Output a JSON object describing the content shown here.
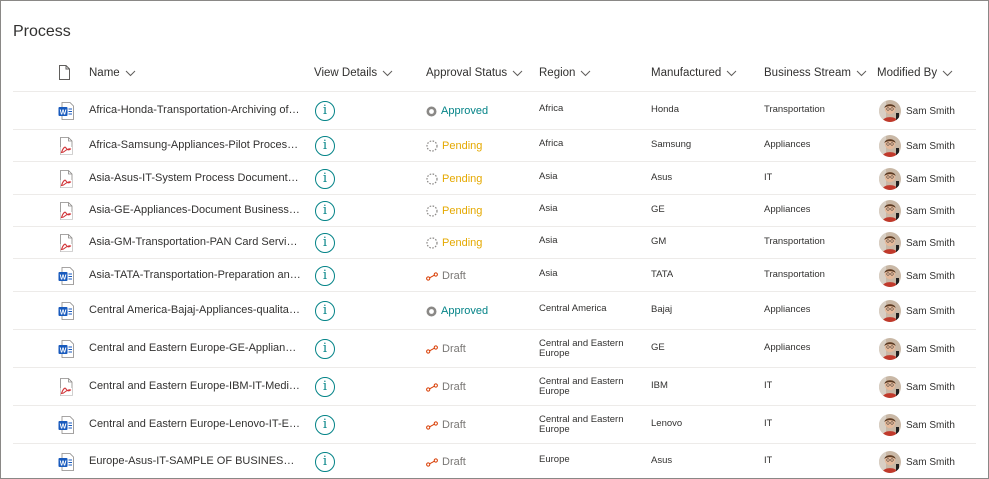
{
  "page": {
    "title": "Process"
  },
  "columns": {
    "name": "Name",
    "view_details": "View Details",
    "approval_status": "Approval Status",
    "region": "Region",
    "manufactured": "Manufactured",
    "business_stream": "Business Stream",
    "modified_by": "Modified By"
  },
  "icons": {
    "file_header": "file-icon",
    "word": "word-doc-icon",
    "pdf": "pdf-icon",
    "view": "info-circle-icon",
    "sort": "chevron-down-icon"
  },
  "colors": {
    "approved": "#038387",
    "pending": "#e5a900",
    "draft": "#d83b01",
    "word": "#185abd",
    "pdf": "#d13438"
  },
  "view_details_glyph": "i",
  "rows": [
    {
      "type": "word",
      "name": "Africa-Honda-Transportation-Archiving of E...",
      "status": "Approved",
      "region": "Africa",
      "manufactured": "Honda",
      "stream": "Transportation",
      "modified_by": "Sam Smith"
    },
    {
      "type": "pdf",
      "name": "Africa-Samsung-Appliances-Pilot Process D...",
      "status": "Pending",
      "region": "Africa",
      "manufactured": "Samsung",
      "stream": "Appliances",
      "modified_by": "Sam Smith"
    },
    {
      "type": "pdf",
      "name": "Asia-Asus-IT-System Process Document.pdf",
      "status": "Pending",
      "region": "Asia",
      "manufactured": "Asus",
      "stream": "IT",
      "modified_by": "Sam Smith"
    },
    {
      "type": "pdf",
      "name": "Asia-GE-Appliances-Document Business Pr...",
      "status": "Pending",
      "region": "Asia",
      "manufactured": "GE",
      "stream": "Appliances",
      "modified_by": "Sam Smith"
    },
    {
      "type": "pdf",
      "name": "Asia-GM-Transportation-PAN Card Service ...",
      "status": "Pending",
      "region": "Asia",
      "manufactured": "GM",
      "stream": "Transportation",
      "modified_by": "Sam Smith"
    },
    {
      "type": "word",
      "name": "Asia-TATA-Transportation-Preparation and ...",
      "status": "Draft",
      "region": "Asia",
      "manufactured": "TATA",
      "stream": "Transportation",
      "modified_by": "Sam Smith"
    },
    {
      "type": "word",
      "name": "Central America-Bajaj-Appliances-qualitativ...",
      "status": "Approved",
      "region": "Central America",
      "manufactured": "Bajaj",
      "stream": "Appliances",
      "modified_by": "Sam Smith"
    },
    {
      "type": "word",
      "name": "Central and Eastern Europe-GE-Appliances-...",
      "status": "Draft",
      "region": "Central and Eastern Europe",
      "manufactured": "GE",
      "stream": "Appliances",
      "modified_by": "Sam Smith"
    },
    {
      "type": "pdf",
      "name": "Central and Eastern Europe-IBM-IT-Medical...",
      "status": "Draft",
      "region": "Central and Eastern Europe",
      "manufactured": "IBM",
      "stream": "IT",
      "modified_by": "Sam Smith"
    },
    {
      "type": "word",
      "name": "Central and Eastern Europe-Lenovo-IT-Ethi...",
      "status": "Draft",
      "region": "Central and Eastern Europe",
      "manufactured": "Lenovo",
      "stream": "IT",
      "modified_by": "Sam Smith"
    },
    {
      "type": "word",
      "name": "Europe-Asus-IT-SAMPLE OF BUSINESS PRO...",
      "status": "Draft",
      "region": "Europe",
      "manufactured": "Asus",
      "stream": "IT",
      "modified_by": "Sam Smith"
    }
  ]
}
